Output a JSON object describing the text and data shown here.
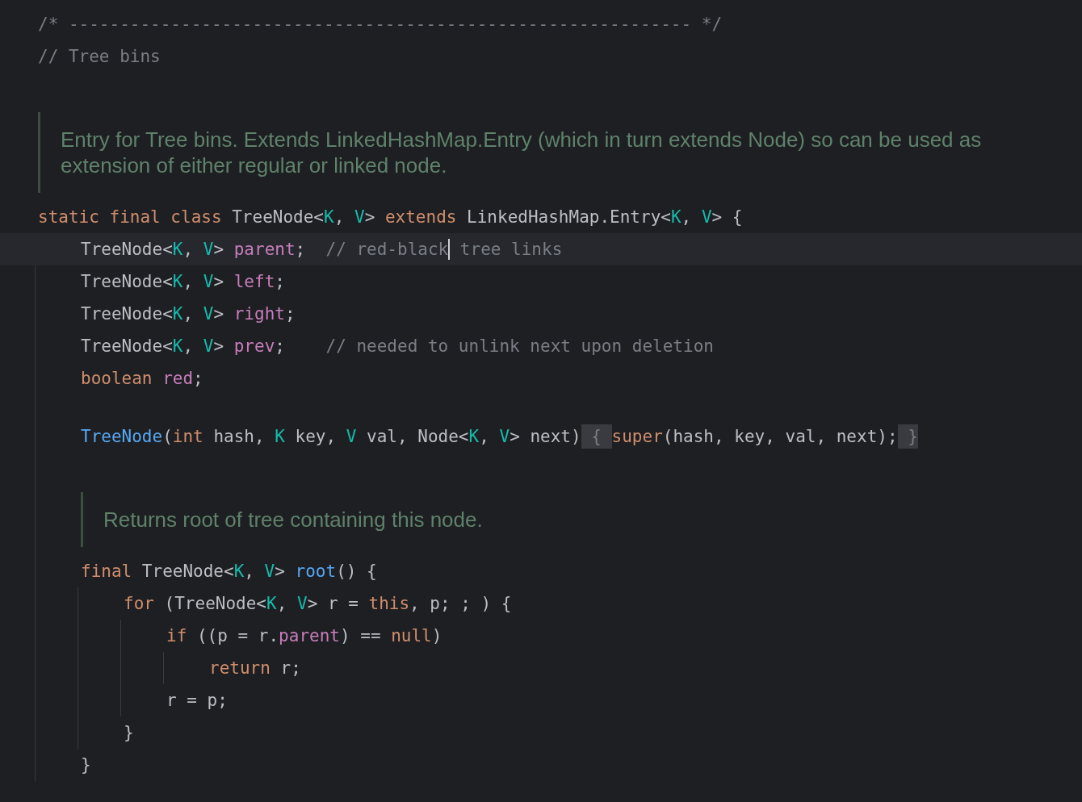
{
  "editor": {
    "lines": [
      {
        "kind": "code",
        "current": false,
        "tokens": [
          {
            "kind": "comment",
            "text": "/* ------------------------------------------------------------- */"
          }
        ]
      },
      {
        "kind": "code",
        "current": false,
        "tokens": [
          {
            "kind": "comment",
            "text": "// Tree bins"
          }
        ]
      },
      {
        "kind": "blank"
      },
      {
        "kind": "doc",
        "text": "Entry for Tree bins. Extends LinkedHashMap.Entry (which in turn extends Node) so can be used as extension of either regular or linked node."
      },
      {
        "kind": "code",
        "current": false,
        "tokens": [
          {
            "kind": "keyword",
            "text": "static final class "
          },
          {
            "kind": "plain",
            "text": "TreeNode<"
          },
          {
            "kind": "typeparam",
            "text": "K"
          },
          {
            "kind": "plain",
            "text": ", "
          },
          {
            "kind": "typeparam",
            "text": "V"
          },
          {
            "kind": "plain",
            "text": "> "
          },
          {
            "kind": "keyword",
            "text": "extends "
          },
          {
            "kind": "plain",
            "text": "LinkedHashMap.Entry<"
          },
          {
            "kind": "typeparam",
            "text": "K"
          },
          {
            "kind": "plain",
            "text": ", "
          },
          {
            "kind": "typeparam",
            "text": "V"
          },
          {
            "kind": "plain",
            "text": "> {"
          }
        ],
        "children": [
          {
            "kind": "code",
            "current": true,
            "tokens": [
              {
                "kind": "plain",
                "text": "TreeNode<"
              },
              {
                "kind": "typeparam",
                "text": "K"
              },
              {
                "kind": "plain",
                "text": ", "
              },
              {
                "kind": "typeparam",
                "text": "V"
              },
              {
                "kind": "plain",
                "text": "> "
              },
              {
                "kind": "field",
                "text": "parent"
              },
              {
                "kind": "plain",
                "text": ";  "
              },
              {
                "kind": "comment",
                "text": "// red-black",
                "caret": true
              },
              {
                "kind": "comment",
                "text": " tree links"
              }
            ]
          },
          {
            "kind": "code",
            "current": false,
            "tokens": [
              {
                "kind": "plain",
                "text": "TreeNode<"
              },
              {
                "kind": "typeparam",
                "text": "K"
              },
              {
                "kind": "plain",
                "text": ", "
              },
              {
                "kind": "typeparam",
                "text": "V"
              },
              {
                "kind": "plain",
                "text": "> "
              },
              {
                "kind": "field",
                "text": "left"
              },
              {
                "kind": "plain",
                "text": ";"
              }
            ]
          },
          {
            "kind": "code",
            "current": false,
            "tokens": [
              {
                "kind": "plain",
                "text": "TreeNode<"
              },
              {
                "kind": "typeparam",
                "text": "K"
              },
              {
                "kind": "plain",
                "text": ", "
              },
              {
                "kind": "typeparam",
                "text": "V"
              },
              {
                "kind": "plain",
                "text": "> "
              },
              {
                "kind": "field",
                "text": "right"
              },
              {
                "kind": "plain",
                "text": ";"
              }
            ]
          },
          {
            "kind": "code",
            "current": false,
            "tokens": [
              {
                "kind": "plain",
                "text": "TreeNode<"
              },
              {
                "kind": "typeparam",
                "text": "K"
              },
              {
                "kind": "plain",
                "text": ", "
              },
              {
                "kind": "typeparam",
                "text": "V"
              },
              {
                "kind": "plain",
                "text": "> "
              },
              {
                "kind": "field",
                "text": "prev"
              },
              {
                "kind": "plain",
                "text": ";    "
              },
              {
                "kind": "comment",
                "text": "// needed to unlink next upon deletion"
              }
            ]
          },
          {
            "kind": "code",
            "current": false,
            "tokens": [
              {
                "kind": "keyword",
                "text": "boolean "
              },
              {
                "kind": "field",
                "text": "red"
              },
              {
                "kind": "plain",
                "text": ";"
              }
            ]
          },
          {
            "kind": "blank"
          },
          {
            "kind": "code",
            "current": false,
            "tokens": [
              {
                "kind": "method",
                "text": "TreeNode"
              },
              {
                "kind": "plain",
                "text": "("
              },
              {
                "kind": "keyword",
                "text": "int"
              },
              {
                "kind": "plain",
                "text": " hash, "
              },
              {
                "kind": "typeparam",
                "text": "K"
              },
              {
                "kind": "plain",
                "text": " key, "
              },
              {
                "kind": "typeparam",
                "text": "V"
              },
              {
                "kind": "plain",
                "text": " val, Node<"
              },
              {
                "kind": "typeparam",
                "text": "K"
              },
              {
                "kind": "plain",
                "text": ", "
              },
              {
                "kind": "typeparam",
                "text": "V"
              },
              {
                "kind": "plain",
                "text": "> next)"
              },
              {
                "kind": "fold",
                "text": " { "
              },
              {
                "kind": "keyword",
                "text": "super"
              },
              {
                "kind": "plain",
                "text": "(hash, key, val, next);"
              },
              {
                "kind": "fold",
                "text": " }"
              }
            ]
          },
          {
            "kind": "blank"
          },
          {
            "kind": "doc",
            "text": "Returns root of tree containing this node."
          },
          {
            "kind": "code",
            "current": false,
            "tokens": [
              {
                "kind": "keyword",
                "text": "final "
              },
              {
                "kind": "plain",
                "text": "TreeNode<"
              },
              {
                "kind": "typeparam",
                "text": "K"
              },
              {
                "kind": "plain",
                "text": ", "
              },
              {
                "kind": "typeparam",
                "text": "V"
              },
              {
                "kind": "plain",
                "text": "> "
              },
              {
                "kind": "method",
                "text": "root"
              },
              {
                "kind": "plain",
                "text": "() {"
              }
            ],
            "children": [
              {
                "kind": "code",
                "current": false,
                "tokens": [
                  {
                    "kind": "keyword",
                    "text": "for"
                  },
                  {
                    "kind": "plain",
                    "text": " (TreeNode<"
                  },
                  {
                    "kind": "typeparam",
                    "text": "K"
                  },
                  {
                    "kind": "plain",
                    "text": ", "
                  },
                  {
                    "kind": "typeparam",
                    "text": "V"
                  },
                  {
                    "kind": "plain",
                    "text": "> r = "
                  },
                  {
                    "kind": "keyword",
                    "text": "this"
                  },
                  {
                    "kind": "plain",
                    "text": ", p; ; ) {"
                  }
                ],
                "children": [
                  {
                    "kind": "code",
                    "current": false,
                    "tokens": [
                      {
                        "kind": "keyword",
                        "text": "if"
                      },
                      {
                        "kind": "plain",
                        "text": " ((p = r."
                      },
                      {
                        "kind": "field",
                        "text": "parent"
                      },
                      {
                        "kind": "plain",
                        "text": ") == "
                      },
                      {
                        "kind": "keyword",
                        "text": "null"
                      },
                      {
                        "kind": "plain",
                        "text": ")"
                      }
                    ],
                    "children": [
                      {
                        "kind": "code",
                        "current": false,
                        "tokens": [
                          {
                            "kind": "keyword",
                            "text": "return"
                          },
                          {
                            "kind": "plain",
                            "text": " r;"
                          }
                        ]
                      }
                    ]
                  },
                  {
                    "kind": "code",
                    "current": false,
                    "tokens": [
                      {
                        "kind": "plain",
                        "text": "r = p;"
                      }
                    ]
                  }
                ]
              },
              {
                "kind": "code",
                "current": false,
                "tokens": [
                  {
                    "kind": "plain",
                    "text": "}"
                  }
                ]
              }
            ]
          },
          {
            "kind": "code",
            "current": false,
            "tokens": [
              {
                "kind": "plain",
                "text": "}"
              }
            ]
          }
        ]
      }
    ]
  }
}
